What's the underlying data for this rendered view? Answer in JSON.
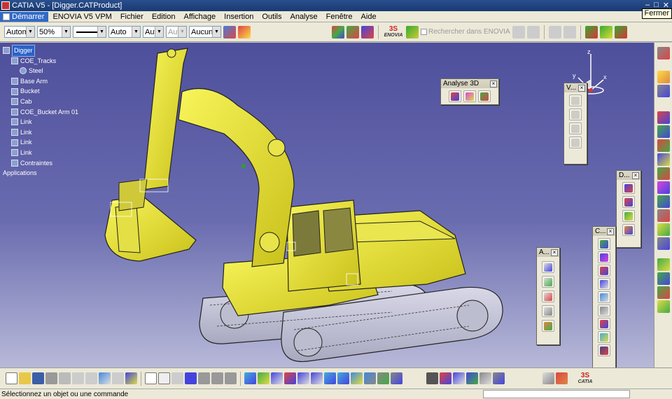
{
  "window": {
    "title": "CATIA V5 - [Digger.CATProduct]",
    "tooltip": "Fermer"
  },
  "menu": [
    "Démarrer",
    "ENOVIA V5 VPM",
    "Fichier",
    "Edition",
    "Affichage",
    "Insertion",
    "Outils",
    "Analyse",
    "Fenêtre",
    "Aide"
  ],
  "toolbar": {
    "combo_1": "Automa",
    "combo_2": "50%",
    "combo_4": "Auto",
    "combo_5": "Aut",
    "combo_6": "Aut",
    "combo_7": "Aucun",
    "enovia_label": "ENOVIA",
    "search_placeholder": "Rechercher dans ENOVIA"
  },
  "tree": {
    "root": "Digger",
    "items": [
      {
        "label": "COE_Tracks",
        "level": 1
      },
      {
        "label": "Steel",
        "level": 2
      },
      {
        "label": "Base Arm",
        "level": 1
      },
      {
        "label": "Bucket",
        "level": 1
      },
      {
        "label": "Cab",
        "level": 1
      },
      {
        "label": "COE_Bucket Arm 01",
        "level": 1
      },
      {
        "label": "Link",
        "level": 1
      },
      {
        "label": "Link",
        "level": 1
      },
      {
        "label": "Link",
        "level": 1
      },
      {
        "label": "Link",
        "level": 1
      },
      {
        "label": "Contraintes",
        "level": 1
      },
      {
        "label": "Applications",
        "level": 0
      }
    ]
  },
  "panels": {
    "analyse3d": "Analyse 3D",
    "v": "V...",
    "d": "D...",
    "c": "C...",
    "a": "A..."
  },
  "compass": {
    "x": "x",
    "y": "y",
    "z": "z"
  },
  "bottom_brand": "CATIA",
  "status": {
    "message": "Sélectionnez un objet ou une commande"
  },
  "colors": {
    "model": "#f3ef2b",
    "background_top": "#4e4f9b",
    "background_bottom": "#b8b9d8",
    "selection": "#2a62c8"
  }
}
